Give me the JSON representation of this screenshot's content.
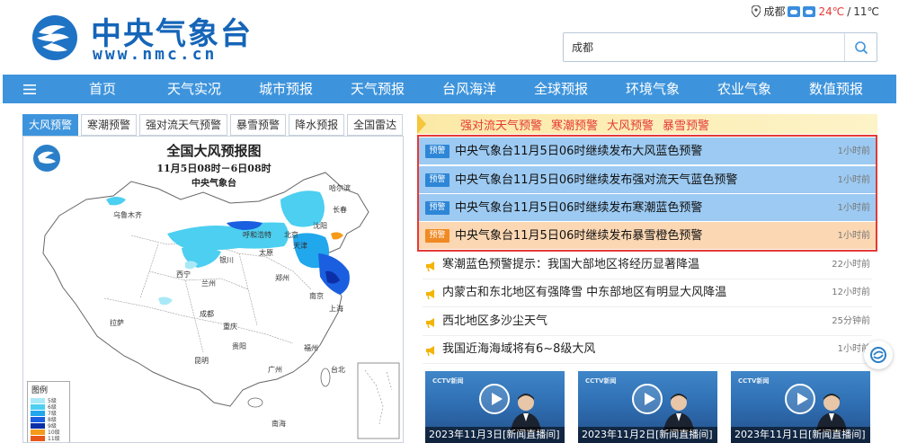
{
  "brand": {
    "name_cn": "中央气象台",
    "domain": "www.nmc.cn",
    "color": "#1565b8"
  },
  "location": {
    "city": "成都",
    "temp_high": "24℃",
    "separator": "/",
    "temp_low": "11℃"
  },
  "search": {
    "value": "成都"
  },
  "nav": {
    "items": [
      "首页",
      "天气实况",
      "城市预报",
      "天气预报",
      "台风海洋",
      "全球预报",
      "环境气象",
      "农业气象",
      "数值预报"
    ]
  },
  "tabs": {
    "items": [
      "大风预警",
      "寒潮预警",
      "强对流天气预警",
      "暴雪预警",
      "降水预报",
      "全国雷达"
    ],
    "active": 0
  },
  "map": {
    "title": "全国大风预报图",
    "subtitle": "11月5日08时－6日08时",
    "org": "中央气象台",
    "legend_title": "图例",
    "legend": [
      {
        "label": "5级",
        "color": "#a9e9f7"
      },
      {
        "label": "6级",
        "color": "#4ccff0"
      },
      {
        "label": "7级",
        "color": "#21a7ec"
      },
      {
        "label": "8级",
        "color": "#1a5fe0"
      },
      {
        "label": "9级",
        "color": "#0c2fa8"
      },
      {
        "label": "10级",
        "color": "#f59a1a"
      },
      {
        "label": "11级",
        "color": "#e8561a"
      }
    ],
    "place_labels": [
      "乌鲁木齐",
      "哈尔滨",
      "长春",
      "呼和浩特",
      "北京",
      "沈阳",
      "天津",
      "太原",
      "银川",
      "郑州",
      "西宁",
      "兰州",
      "南京",
      "上海",
      "拉萨",
      "成都",
      "重庆",
      "贵阳",
      "昆明",
      "广州",
      "福州",
      "台北",
      "南海"
    ]
  },
  "alert_bar": {
    "items": [
      "强对流天气预警",
      "寒潮预警",
      "大风预警",
      "暴雪预警"
    ],
    "accent": "#e53935"
  },
  "warnings": [
    {
      "badge": "预警",
      "level": "blue",
      "text": "中央气象台11月5日06时继续发布大风蓝色预警",
      "time": "1小时前"
    },
    {
      "badge": "预警",
      "level": "blue",
      "text": "中央气象台11月5日06时继续发布强对流天气蓝色预警",
      "time": "1小时前"
    },
    {
      "badge": "预警",
      "level": "blue",
      "text": "中央气象台11月5日06时继续发布寒潮蓝色预警",
      "time": "1小时前"
    },
    {
      "badge": "预警",
      "level": "orange",
      "text": "中央气象台11月5日06时继续发布暴雪橙色预警",
      "time": "1小时前"
    }
  ],
  "news": [
    {
      "text": "寒潮蓝色预警提示：我国大部地区将经历显著降温",
      "time": "22小时前"
    },
    {
      "text": "内蒙古和东北地区有强降雪 中东部地区有明显大风降温",
      "time": "12小时前"
    },
    {
      "text": "西北地区多沙尘天气",
      "time": "25分钟前"
    },
    {
      "text": "我国近海海域将有6~8级大风",
      "time": "1小时前"
    }
  ],
  "videos": [
    {
      "caption": "2023年11月3日[新闻直播间]",
      "tag": "CCTV新闻"
    },
    {
      "caption": "2023年11月2日[新闻直播间]",
      "tag": "CCTV新闻"
    },
    {
      "caption": "2023年11月1日[新闻直播间]",
      "tag": "CCTV新闻"
    }
  ]
}
